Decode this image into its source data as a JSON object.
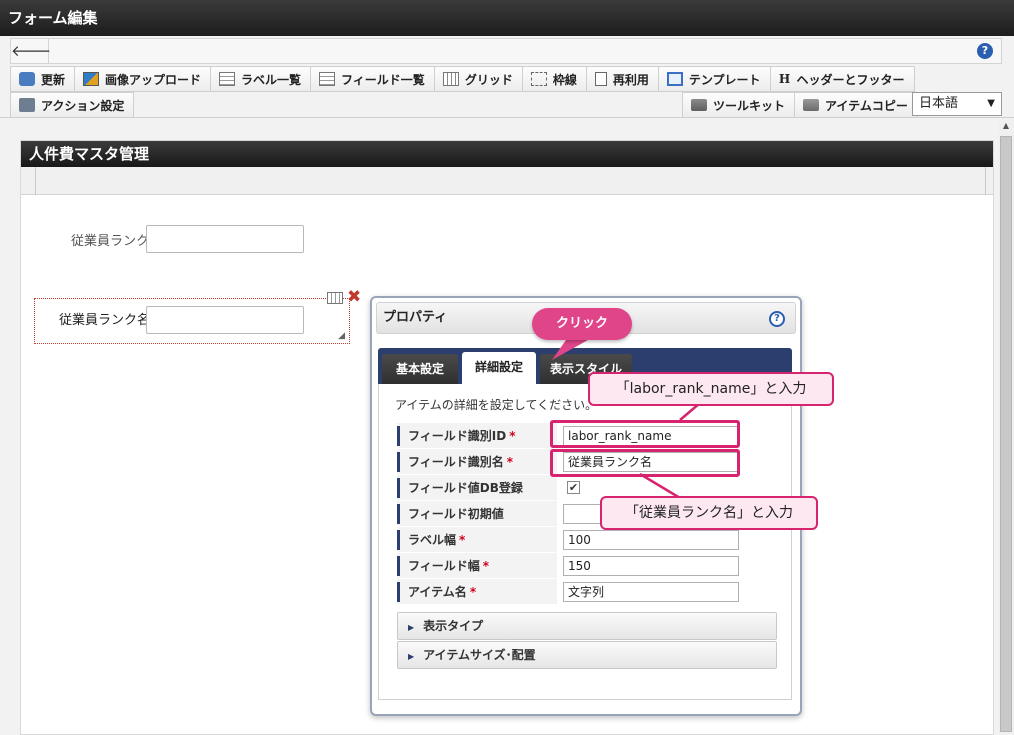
{
  "window": {
    "title": "フォーム編集"
  },
  "toolbar": {
    "back_icon": "arrow-left-icon",
    "help_icon": "help-icon",
    "help_glyph": "?",
    "row1": [
      {
        "key": "refresh",
        "label": "更新",
        "icon": "refresh-icon"
      },
      {
        "key": "image-upload",
        "label": "画像アップロード",
        "icon": "image-icon"
      },
      {
        "key": "label-list",
        "label": "ラベル一覧",
        "icon": "list-icon"
      },
      {
        "key": "field-list",
        "label": "フィールド一覧",
        "icon": "list-icon"
      },
      {
        "key": "grid",
        "label": "グリッド",
        "icon": "grid-icon"
      },
      {
        "key": "border",
        "label": "枠線",
        "icon": "border-icon"
      },
      {
        "key": "reuse",
        "label": "再利用",
        "icon": "document-icon"
      },
      {
        "key": "template",
        "label": "テンプレート",
        "icon": "template-icon"
      },
      {
        "key": "header-footer",
        "label": "ヘッダーとフッター",
        "icon": "h-icon",
        "glyph": "H"
      }
    ],
    "row2_left": [
      {
        "key": "action-settings",
        "label": "アクション設定",
        "icon": "action-icon"
      }
    ],
    "row2_right": [
      {
        "key": "toolkit",
        "label": "ツールキット",
        "icon": "toolbox-icon"
      },
      {
        "key": "item-copy",
        "label": "アイテムコピー",
        "icon": "toolbox-icon"
      }
    ],
    "language": {
      "selected": "日本語",
      "arrow": "▼"
    }
  },
  "form": {
    "title": "人件費マスタ管理",
    "fields": [
      {
        "label": "従業員ランク",
        "value": ""
      },
      {
        "label": "従業員ランク名",
        "value": "",
        "selected": true
      }
    ]
  },
  "properties": {
    "title": "プロパティ",
    "help_glyph": "?",
    "tabs": [
      {
        "label": "基本設定",
        "active": false
      },
      {
        "label": "詳細設定",
        "active": true
      },
      {
        "label": "表示スタイル",
        "active": false
      }
    ],
    "description": "アイテムの詳細を設定してください。",
    "rows": [
      {
        "label": "フィールド識別ID",
        "required": true,
        "type": "text",
        "value": "labor_rank_name"
      },
      {
        "label": "フィールド識別名",
        "required": true,
        "type": "text",
        "value": "従業員ランク名"
      },
      {
        "label": "フィールド値DB登録",
        "required": false,
        "type": "checkbox",
        "checked": true,
        "value": "✔"
      },
      {
        "label": "フィールド初期値",
        "required": false,
        "type": "text",
        "value": ""
      },
      {
        "label": "ラベル幅",
        "required": true,
        "type": "text",
        "value": "100"
      },
      {
        "label": "フィールド幅",
        "required": true,
        "type": "text",
        "value": "150"
      },
      {
        "label": "アイテム名",
        "required": true,
        "type": "text",
        "value": "文字列"
      }
    ],
    "required_mark": "*",
    "sections": [
      {
        "label": "表示タイプ",
        "arrow": "▶"
      },
      {
        "label": "アイテムサイズ･配置",
        "arrow": "▶"
      }
    ]
  },
  "annotations": {
    "click": "クリック",
    "input_id": "「labor_rank_name」と入力",
    "input_name": "「従業員ランク名」と入力"
  },
  "colors": {
    "accent": "#d6246e",
    "tab_bar": "#2c3e6d",
    "delete": "#c0392b"
  }
}
